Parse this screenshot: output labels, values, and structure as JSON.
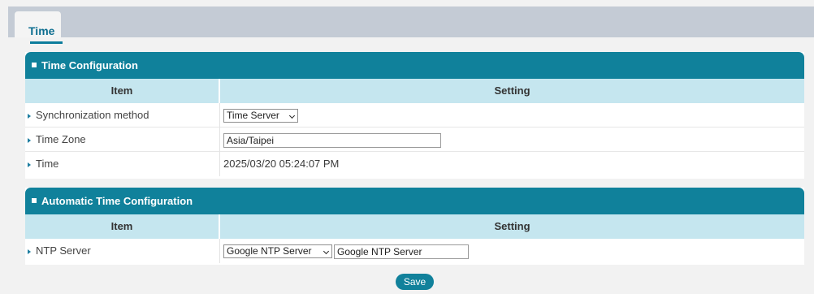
{
  "tabs": [
    {
      "label": "Time",
      "active": true
    }
  ],
  "time_configuration": {
    "title": "Time Configuration",
    "col_item": "Item",
    "col_setting": "Setting",
    "rows": [
      {
        "label": "Synchronization method",
        "control": "select",
        "value": "Time Server"
      },
      {
        "label": "Time Zone",
        "control": "text-input",
        "value": "Asia/Taipei"
      },
      {
        "label": "Time",
        "control": "text",
        "value": "2025/03/20 05:24:07 PM"
      }
    ]
  },
  "automatic_time_configuration": {
    "title": "Automatic Time Configuration",
    "col_item": "Item",
    "col_setting": "Setting",
    "rows": [
      {
        "label": "NTP Server",
        "control": "select+text-input",
        "select_value": "Google NTP Server",
        "input_value": "Google NTP Server"
      }
    ]
  },
  "actions": {
    "save_label": "Save"
  },
  "colors": {
    "accent": "#10819b",
    "column_header": "#c5e6ef",
    "tab_strip": "#c4cbd5",
    "active_tab_text": "#0c6d8f"
  },
  "icons": {
    "row_marker": "caret-right-icon",
    "panel_marker": "square-bullet-icon",
    "dropdown": "chevron-down-icon"
  }
}
